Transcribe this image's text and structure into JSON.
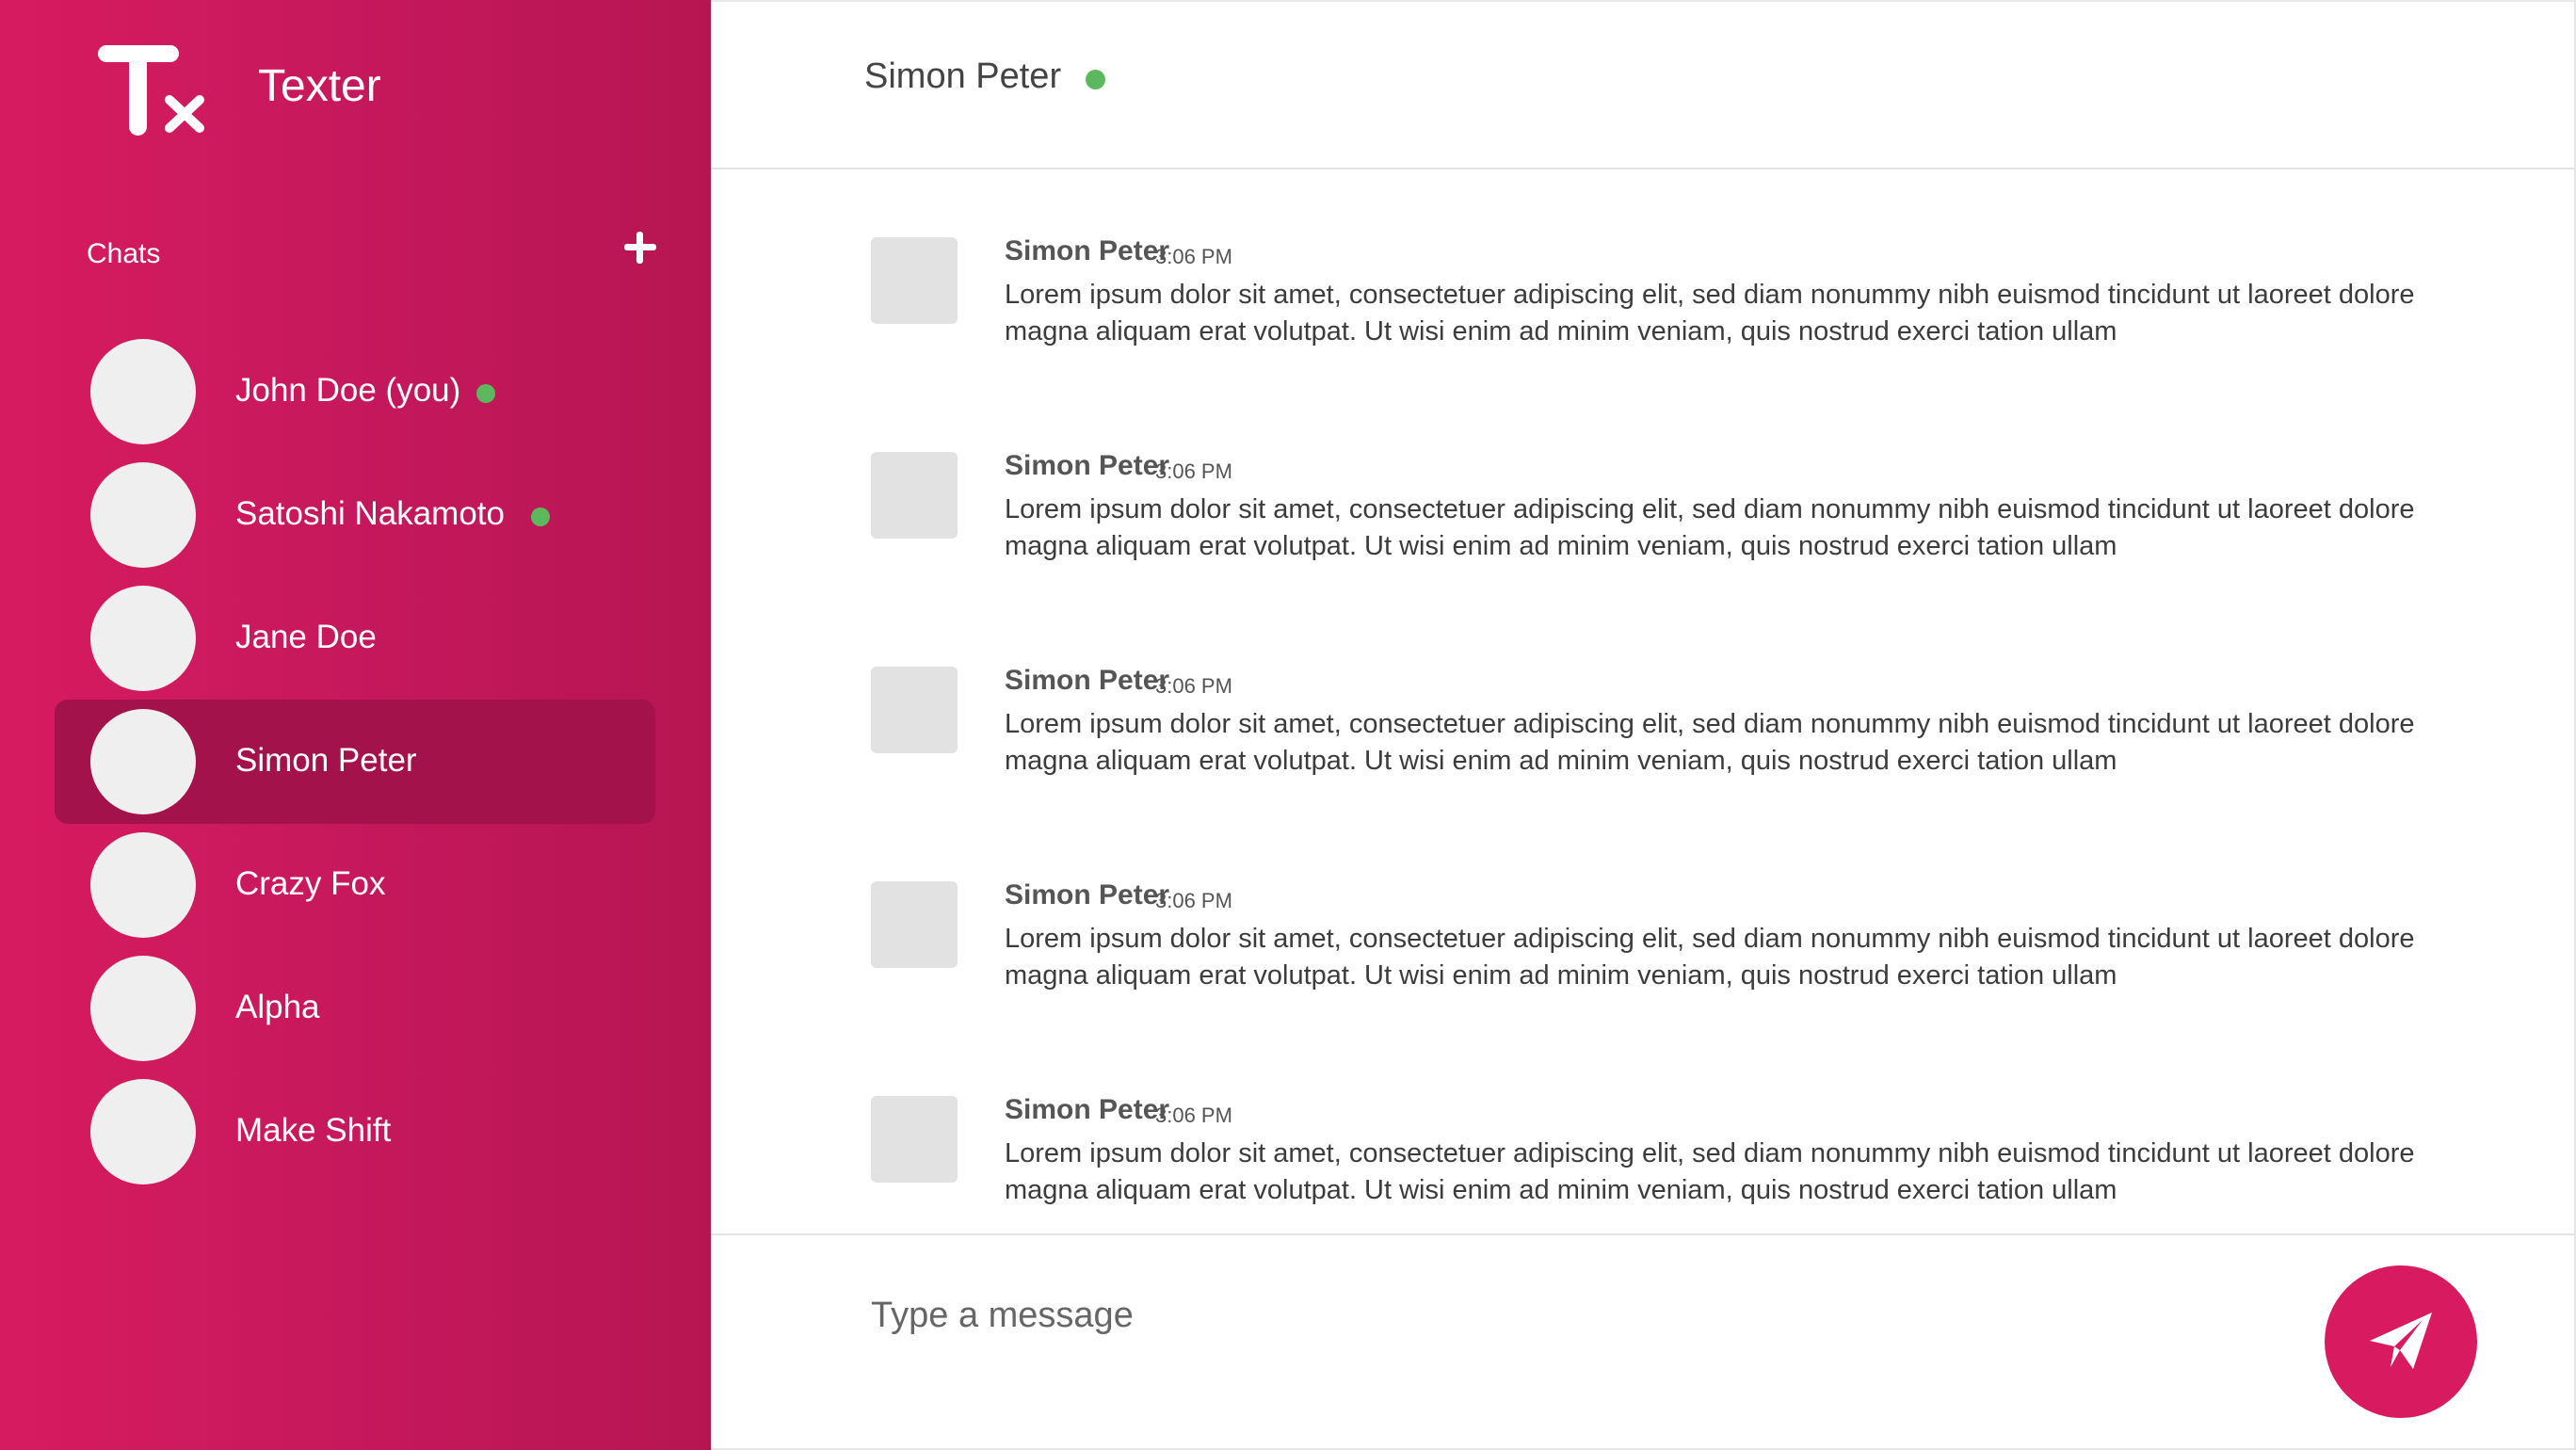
{
  "app": {
    "title": "Texter"
  },
  "sidebar": {
    "chats_label": "Chats",
    "chats": [
      {
        "name": "John Doe (you)",
        "online": true,
        "active": false
      },
      {
        "name": "Satoshi Nakamoto",
        "online": true,
        "active": false
      },
      {
        "name": "Jane Doe",
        "online": false,
        "active": false
      },
      {
        "name": "Simon Peter",
        "online": false,
        "active": true
      },
      {
        "name": "Crazy Fox",
        "online": false,
        "active": false
      },
      {
        "name": "Alpha",
        "online": false,
        "active": false
      },
      {
        "name": "Make Shift",
        "online": false,
        "active": false
      }
    ]
  },
  "conversation": {
    "contact_name": "Simon Peter",
    "contact_online": true,
    "messages": [
      {
        "author": "Simon Peter",
        "time": "3:06 PM",
        "text": "Lorem ipsum dolor sit amet, consectetuer adipiscing elit, sed diam nonummy nibh euismod tincidunt ut laoreet dolore magna aliquam erat volutpat. Ut wisi enim ad minim veniam, quis nostrud exerci tation ullam"
      },
      {
        "author": "Simon Peter",
        "time": "3:06 PM",
        "text": "Lorem ipsum dolor sit amet, consectetuer adipiscing elit, sed diam nonummy nibh euismod tincidunt ut laoreet dolore magna aliquam erat volutpat. Ut wisi enim ad minim veniam, quis nostrud exerci tation ullam"
      },
      {
        "author": "Simon Peter",
        "time": "3:06 PM",
        "text": "Lorem ipsum dolor sit amet, consectetuer adipiscing elit, sed diam nonummy nibh euismod tincidunt ut laoreet dolore magna aliquam erat volutpat. Ut wisi enim ad minim veniam, quis nostrud exerci tation ullam"
      },
      {
        "author": "Simon Peter",
        "time": "3:06 PM",
        "text": "Lorem ipsum dolor sit amet, consectetuer adipiscing elit, sed diam nonummy nibh euismod tincidunt ut laoreet dolore magna aliquam erat volutpat. Ut wisi enim ad minim veniam, quis nostrud exerci tation ullam"
      },
      {
        "author": "Simon Peter",
        "time": "3:06 PM",
        "text": "Lorem ipsum dolor sit amet, consectetuer adipiscing elit, sed diam nonummy nibh euismod tincidunt ut laoreet dolore magna aliquam erat volutpat. Ut wisi enim ad minim veniam, quis nostrud exerci tation ullam"
      }
    ]
  },
  "composer": {
    "placeholder": "Type a message",
    "value": ""
  },
  "icons": {
    "logo": "texter-logo-icon",
    "add_chat": "plus-icon",
    "send": "paper-plane-icon",
    "online": "online-status-icon"
  },
  "colors": {
    "brand": "#d81b60",
    "brand_dark": "#b71552",
    "active_chat": "#a3124a",
    "online": "#5cb85c",
    "avatar": "#efefef"
  }
}
